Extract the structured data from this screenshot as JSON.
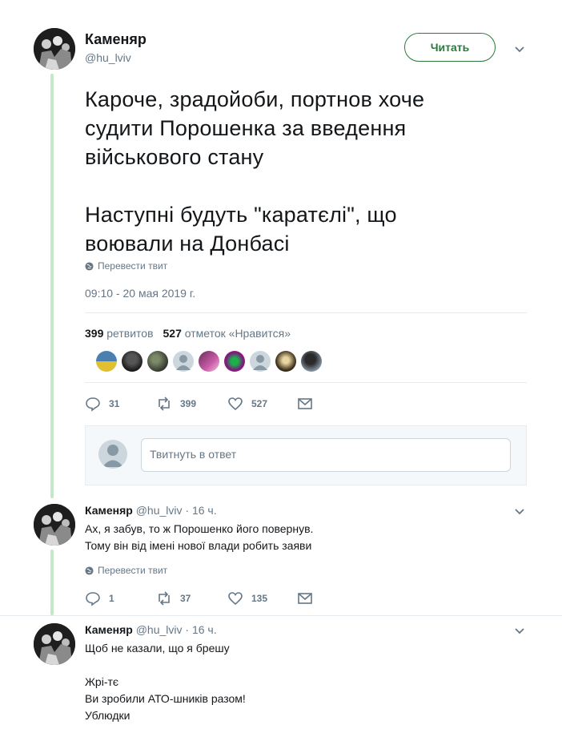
{
  "main_tweet": {
    "author_name": "Каменяр",
    "author_handle": "@hu_lviv",
    "follow_label": "Читать",
    "text_line1": "Кароче, зрадойоби, портнов хоче",
    "text_line2": "судити Порошенка за введення",
    "text_line3": "військового стану",
    "text_line4": "Наступні будуть \"каратєлі\", що",
    "text_line5": "воювали на Донбасі",
    "translate_label": "Перевести твит",
    "timestamp": "09:10 - 20 мая 2019 г.",
    "retweets_count": "399",
    "retweets_label": "ретвитов",
    "likes_count": "527",
    "likes_label": "отметок «Нравится»",
    "actions": {
      "replies": "31",
      "retweets": "399",
      "likes": "527"
    },
    "reply_placeholder": "Твитнуть в ответ"
  },
  "replies": [
    {
      "author_name": "Каменяр",
      "author_handle": "@hu_lviv",
      "time": "· 16 ч.",
      "line1": "Ах, я забув, то ж Порошенко його повернув.",
      "line2": "Тому він від імені нової влади робить заяви",
      "translate_label": "Перевести твит",
      "actions": {
        "replies": "1",
        "retweets": "37",
        "likes": "135"
      }
    },
    {
      "author_name": "Каменяр",
      "author_handle": "@hu_lviv",
      "time": "· 16 ч.",
      "line1": "Щоб не казали, що я брешу",
      "line2": "Жрі-тє",
      "line3": "Ви зробили АТО-шників разом!",
      "line4": "Ублюдки"
    }
  ],
  "icons": {
    "reply": "reply-icon",
    "retweet": "retweet-icon",
    "like": "heart-icon",
    "dm": "envelope-icon",
    "globe": "globe-icon",
    "chevron": "chevron-down-icon"
  },
  "colors": {
    "accent_green": "#2a7a3c",
    "thread_line": "#c4e7c9",
    "muted": "#657786"
  }
}
